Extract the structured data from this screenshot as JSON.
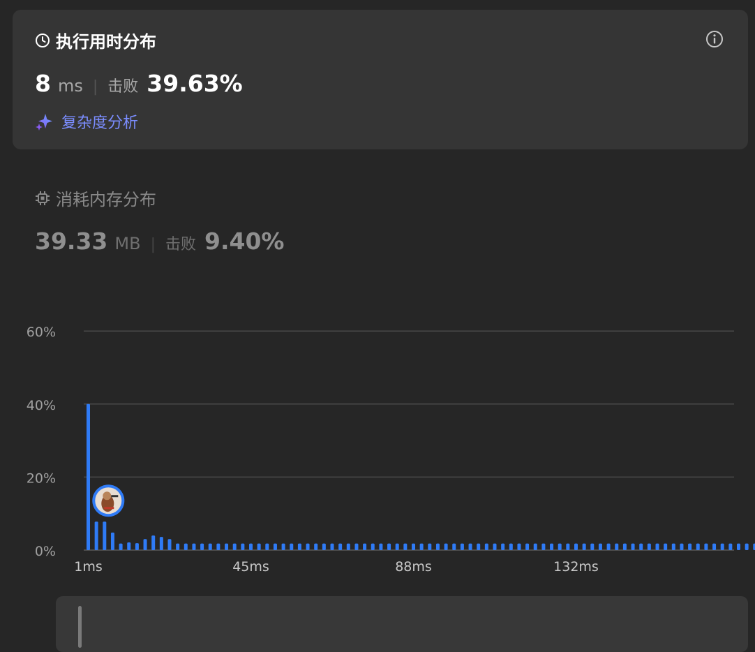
{
  "runtime": {
    "title": "执行用时分布",
    "value": "8",
    "unit": "ms",
    "beat_label": "击败",
    "beat_value": "39.63%",
    "complexity_link": "复杂度分析",
    "icons": [
      "clock-icon",
      "info-icon",
      "sparkle-icon"
    ]
  },
  "memory": {
    "title": "消耗内存分布",
    "value": "39.33",
    "unit": "MB",
    "beat_label": "击败",
    "beat_value": "9.40%",
    "icons": [
      "chip-icon"
    ]
  },
  "colors": {
    "bar": "#2f7bf6",
    "accent_link": "#7b8dff",
    "card_bg": "#353535",
    "page_bg": "#262626"
  },
  "chart_data": {
    "type": "bar",
    "title": "",
    "xlabel": "",
    "ylabel": "",
    "y_ticks": [
      "60%",
      "40%",
      "20%",
      "0%"
    ],
    "ylim": [
      0,
      60
    ],
    "x_tick_labels": [
      "1ms",
      "45ms",
      "88ms",
      "132ms"
    ],
    "user_marker_index": 2,
    "values": [
      40,
      7.8,
      7.8,
      4.8,
      1.8,
      2.1,
      1.9,
      3.0,
      4.0,
      3.6,
      3.0,
      1.8,
      1.8,
      1.8,
      1.8,
      1.8,
      1.8,
      1.8,
      1.8,
      1.8,
      1.8,
      1.8,
      1.8,
      1.8,
      1.8,
      1.8,
      1.8,
      1.8,
      1.8,
      1.8,
      1.8,
      1.8,
      1.8,
      1.8,
      1.8,
      1.8,
      1.8,
      1.8,
      1.8,
      1.8,
      1.8,
      1.8,
      1.8,
      1.8,
      1.8,
      1.8,
      1.8,
      1.8,
      1.8,
      1.8,
      1.8,
      1.8,
      1.8,
      1.8,
      1.8,
      1.8,
      1.8,
      1.8,
      1.8,
      1.8,
      1.8,
      1.8,
      1.8,
      1.8,
      1.8,
      1.8,
      1.8,
      1.8,
      1.8,
      1.8,
      1.8,
      1.8,
      1.8,
      1.8,
      1.8,
      1.8,
      1.8,
      1.8,
      1.8,
      1.8,
      1.8,
      1.8,
      1.8
    ]
  }
}
